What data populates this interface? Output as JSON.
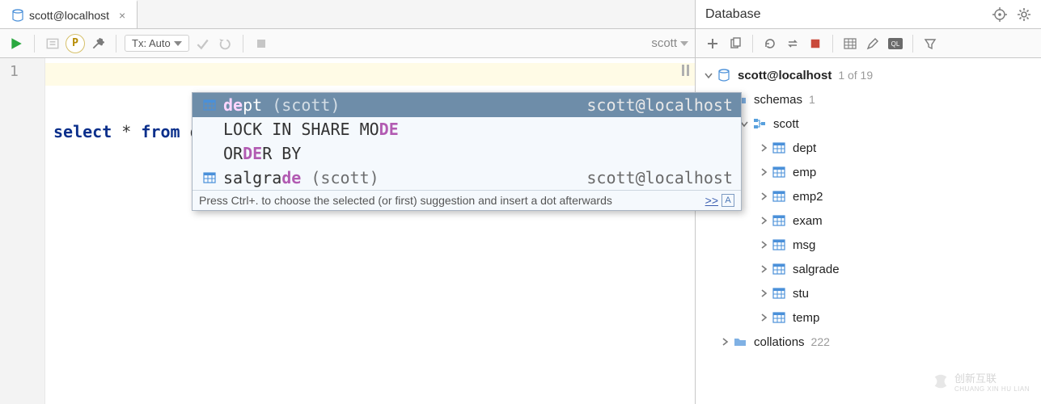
{
  "tab": {
    "label": "scott@localhost"
  },
  "editor_toolbar": {
    "tx_label": "Tx: Auto",
    "schema_label": "scott"
  },
  "editor": {
    "line_number": "1",
    "code_tokens": {
      "k1": "select",
      "t1": " * ",
      "k2": "from",
      "t2": " de"
    }
  },
  "autocomplete": {
    "items": [
      {
        "icon": "table",
        "pre": "de",
        "post": "pt",
        "extra": " (scott)",
        "rhs": "scott@localhost",
        "selected": true
      },
      {
        "icon": null,
        "parts": [
          {
            "txt": "LOCK IN SHARE MO"
          },
          {
            "match": "DE"
          }
        ]
      },
      {
        "icon": null,
        "parts": [
          {
            "txt": "OR"
          },
          {
            "match": "DE"
          },
          {
            "txt": "R BY"
          }
        ]
      },
      {
        "icon": "table",
        "parts": [
          {
            "txt": "salgra"
          },
          {
            "match": "de"
          }
        ],
        "extra": " (scott)",
        "rhs": "scott@localhost"
      }
    ],
    "hint": "Press Ctrl+. to choose the selected (or first) suggestion and insert a dot afterwards",
    "hint_link": ">>"
  },
  "database_panel": {
    "title": "Database",
    "datasource": {
      "name": "scott@localhost",
      "hint": "1 of 19"
    },
    "schemas_label": "schemas",
    "schemas_hint": "1",
    "schema_name": "scott",
    "tables": [
      "dept",
      "emp",
      "emp2",
      "exam",
      "msg",
      "salgrade",
      "stu",
      "temp"
    ],
    "collations_label": "collations",
    "collations_hint": "222"
  },
  "watermark": {
    "brand_cn": "创新互联",
    "brand_en": "CHUANG XIN HU LIAN"
  }
}
